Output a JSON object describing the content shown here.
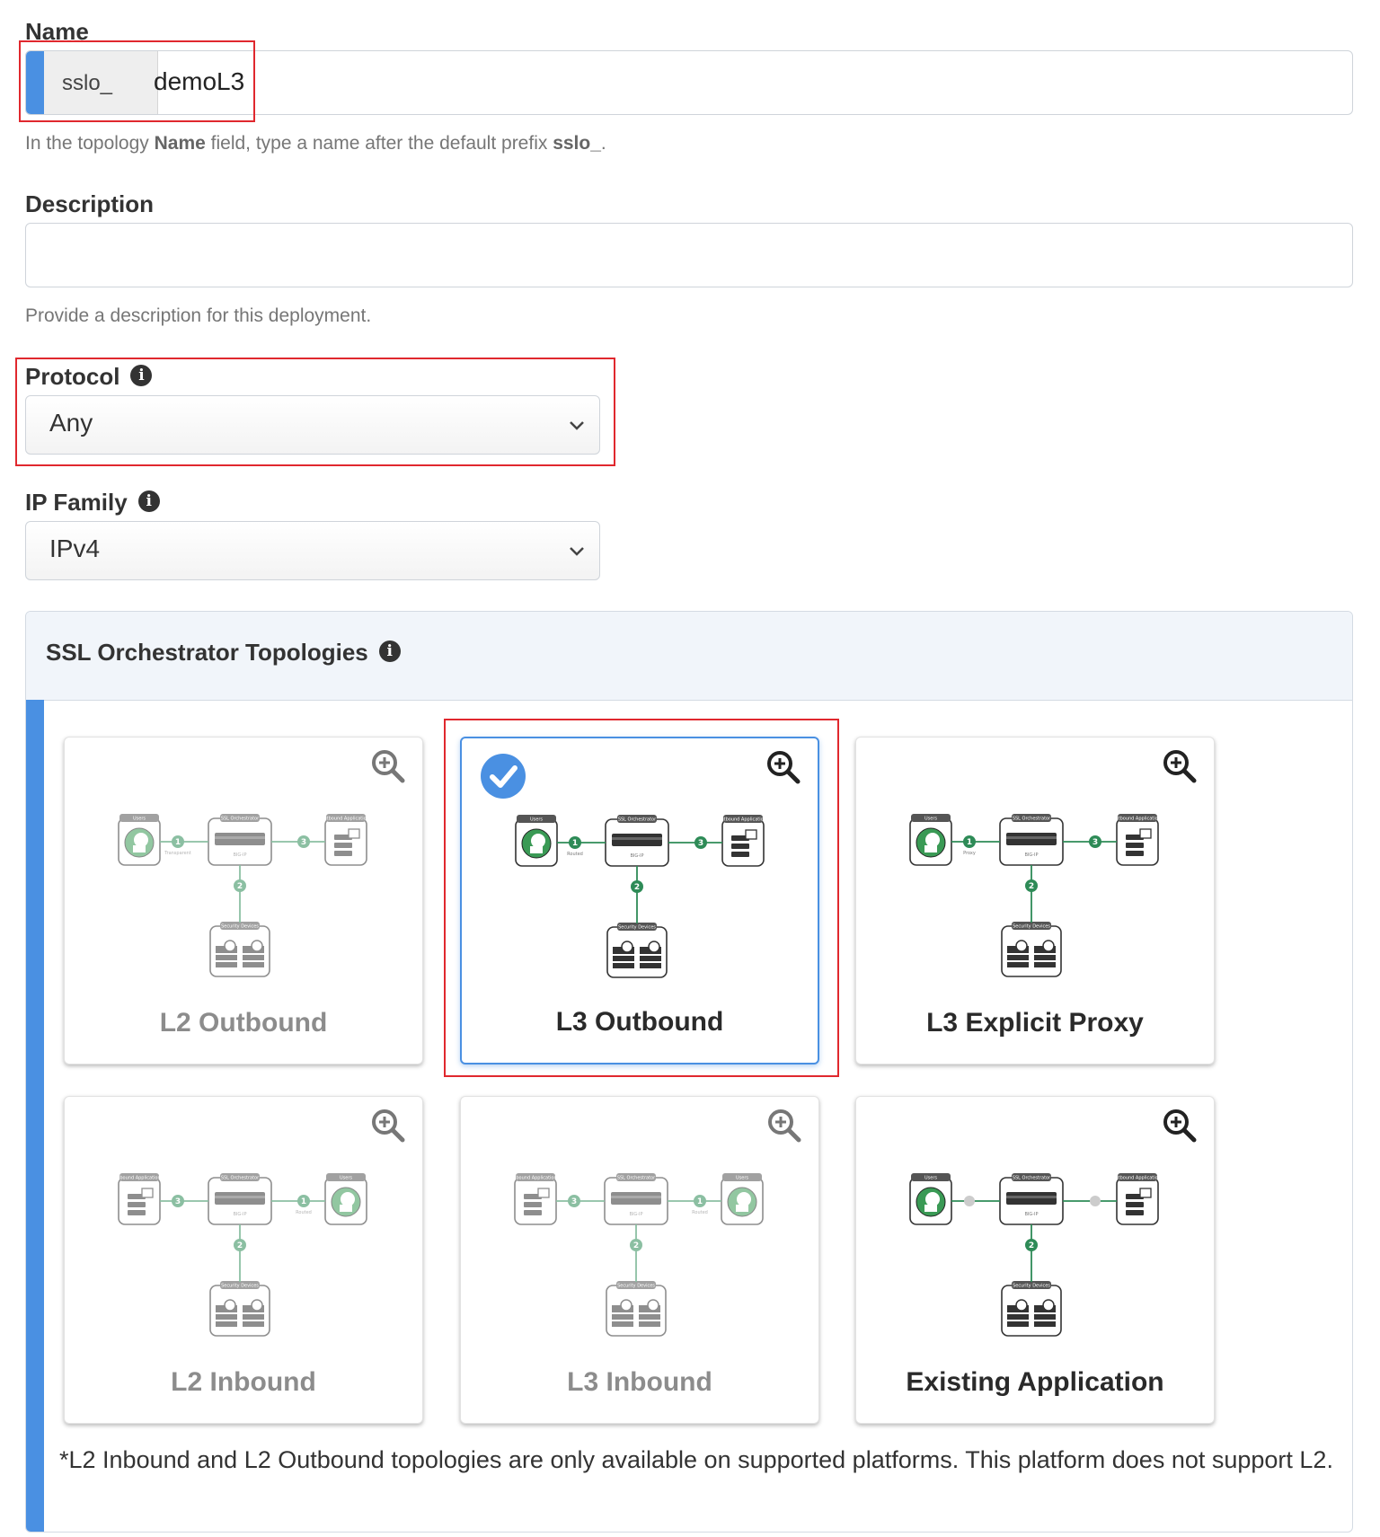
{
  "name_field": {
    "label": "Name",
    "prefix": "sslo_",
    "value": "demoL3",
    "help_pre": "In the topology ",
    "help_bold1": "Name",
    "help_mid": " field, type a name after the default prefix ",
    "help_bold2": "sslo_",
    "help_post": "."
  },
  "description_field": {
    "label": "Description",
    "value": "",
    "help": "Provide a description for this deployment."
  },
  "protocol_field": {
    "label": "Protocol",
    "selected": "Any",
    "info_icon": "info-icon"
  },
  "ip_family_field": {
    "label": "IP Family",
    "selected": "IPv4",
    "info_icon": "info-icon"
  },
  "topologies": {
    "title": "SSL Orchestrator Topologies",
    "note": "*L2 Inbound and L2 Outbound topologies are only available on supported platforms. This platform does not support L2.",
    "diagram_labels": {
      "users": "Users",
      "ssl_orchestrator": "SSL Orchestrator",
      "bigip": "BIG-IP",
      "security_devices": "Security Devices",
      "outbound_apps": "Outbound Applications",
      "inbound_apps": "Inbound Applications",
      "transparent": "Transparent",
      "routed": "Routed",
      "proxy": "Proxy"
    },
    "tiles": [
      {
        "name": "L2 Outbound",
        "state": "disabled",
        "selected": false
      },
      {
        "name": "L3 Outbound",
        "state": "enabled",
        "selected": true
      },
      {
        "name": "L3 Explicit Proxy",
        "state": "enabled",
        "selected": false
      },
      {
        "name": "L2 Inbound",
        "state": "disabled",
        "selected": false
      },
      {
        "name": "L3 Inbound",
        "state": "disabled",
        "selected": false
      },
      {
        "name": "Existing Application",
        "state": "enabled",
        "selected": false
      }
    ]
  },
  "colors": {
    "accent_blue": "#4a90e2",
    "highlight_red": "#e0282e",
    "diagram_green": "#2e8b57"
  }
}
